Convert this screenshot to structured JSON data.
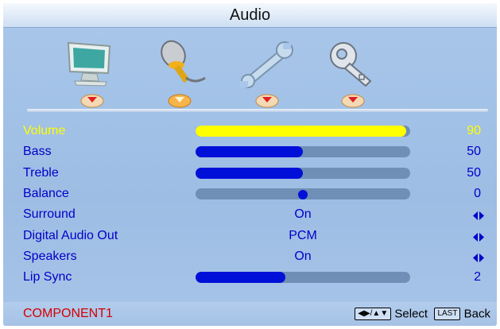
{
  "title": "Audio",
  "tabs": [
    {
      "icon": "monitor-icon"
    },
    {
      "icon": "microphone-icon"
    },
    {
      "icon": "wrench-icon"
    },
    {
      "icon": "key-icon"
    }
  ],
  "settings": [
    {
      "label": "Volume",
      "type": "slider",
      "level": 0.98,
      "value": "90"
    },
    {
      "label": "Bass",
      "type": "slider",
      "level": 0.5,
      "value": "50"
    },
    {
      "label": "Treble",
      "type": "slider",
      "level": 0.5,
      "value": "50"
    },
    {
      "label": "Balance",
      "type": "balance",
      "level": 0.5,
      "value": "0"
    },
    {
      "label": "Surround",
      "type": "option",
      "value": "On"
    },
    {
      "label": "Digital Audio Out",
      "type": "option",
      "value": "PCM"
    },
    {
      "label": "Speakers",
      "type": "option",
      "value": "On"
    },
    {
      "label": "Lip Sync",
      "type": "slider",
      "level": 0.42,
      "value": "2"
    }
  ],
  "footer": {
    "source": "COMPONENT1",
    "select_label": "Select",
    "last_key": "LAST",
    "back_label": "Back"
  },
  "colors": {
    "accent_selected": "#ffff00",
    "text": "#0000c8",
    "source": "#d40000"
  }
}
